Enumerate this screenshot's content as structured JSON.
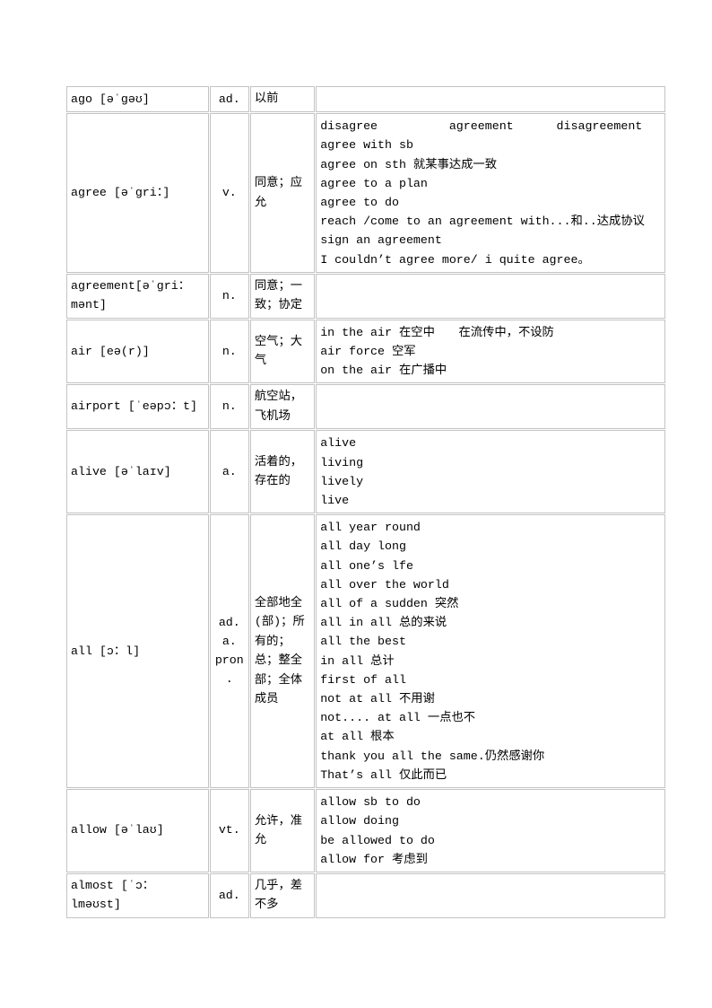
{
  "document": {
    "type": "vocabulary-table",
    "columns": [
      "word",
      "pos",
      "meaning",
      "examples"
    ]
  },
  "rows": [
    {
      "word": "ago [əˈgəʊ]",
      "pos": [
        "ad."
      ],
      "meaning": [
        "以前"
      ],
      "examples": []
    },
    {
      "word": "agree [əˈgri：]",
      "pos": [
        "v."
      ],
      "meaning": [
        "同意；应允"
      ],
      "examples": [
        "disagree          agreement      disagreement",
        "agree with sb",
        "agree on sth 就某事达成一致",
        "agree to a plan",
        "agree to do",
        "reach /come to an agreement with...和..达成协议",
        "sign an agreement",
        "I couldn’t agree more/ i quite agree。"
      ]
    },
    {
      "word": "agreement[əˈgri：mənt]",
      "pos": [
        "n."
      ],
      "meaning": [
        "同意；一致；协定"
      ],
      "examples": []
    },
    {
      "word": "air [eə(r)]",
      "pos": [
        "n."
      ],
      "meaning": [
        "空气；大气"
      ],
      "examples": [
        "in the air 在空中　　在流传中，不设防",
        "air force 空军",
        "on the air 在广播中"
      ]
    },
    {
      "word": "airport [ˈeəpɔ：t]",
      "pos": [
        "n."
      ],
      "meaning": [
        "航空站，飞机场"
      ],
      "examples": []
    },
    {
      "word": "alive [əˈlaɪv]",
      "pos": [
        "a."
      ],
      "meaning": [
        "活着的，存在的"
      ],
      "examples": [
        "alive",
        "living",
        "lively",
        "live"
      ]
    },
    {
      "word": "all [ɔ：l]",
      "pos": [
        "ad.",
        "a.",
        "pron."
      ],
      "meaning": [
        "全部地全(部)；所有的；总；整全部；全体成员"
      ],
      "examples": [
        "all year round",
        "all day long",
        "all one’s lfe",
        "all over the world",
        "all of a sudden 突然",
        "all in all 总的来说",
        "all the best",
        "in all 总计",
        "first of all",
        "not at all 不用谢",
        "not.... at all 一点也不",
        "at all 根本",
        "thank you all the same.仍然感谢你",
        "That’s all 仅此而已"
      ]
    },
    {
      "word": "allow [əˈlaʊ]",
      "pos": [
        "vt."
      ],
      "meaning": [
        "允许，准允"
      ],
      "examples": [
        "allow sb to do",
        "allow doing",
        "be allowed to do",
        "allow for 考虑到"
      ]
    },
    {
      "word": "almost [ˈɔ：lməʊst]",
      "pos": [
        "ad."
      ],
      "meaning": [
        "几乎，差不多"
      ],
      "examples": []
    }
  ],
  "style": {
    "border_color": "#c3c3c3",
    "text_color": "#000000",
    "background": "#ffffff"
  }
}
